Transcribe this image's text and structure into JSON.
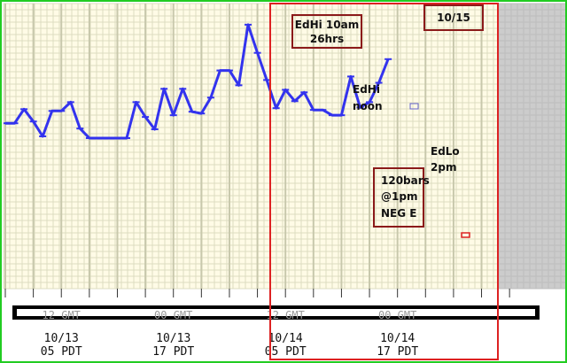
{
  "chart_data": {
    "type": "line",
    "title": "",
    "xlabel": "",
    "ylabel": "",
    "grid": true,
    "colors": {
      "background": "#fffbe6",
      "minor_grid": "#dcdcc0",
      "major_grid": "#c8c8ac",
      "line": "#3333ee",
      "highlight_box": "#dd2222",
      "annotation_border": "#8b1a1a",
      "outer_border": "#22cc22",
      "shaded": "#cccccc"
    },
    "x_range": [
      0,
      56.5
    ],
    "y_range": [
      0,
      100
    ],
    "series": [
      {
        "values": [
          {
            "x": 0,
            "y": 54.5
          },
          {
            "x": 1,
            "y": 54.5
          },
          {
            "x": 2,
            "y": 60.1
          },
          {
            "x": 3,
            "y": 55.2
          },
          {
            "x": 4,
            "y": 49.3
          },
          {
            "x": 5,
            "y": 59.4
          },
          {
            "x": 6,
            "y": 59.4
          },
          {
            "x": 7,
            "y": 62.9
          },
          {
            "x": 8,
            "y": 52.4
          },
          {
            "x": 9,
            "y": 48.6
          },
          {
            "x": 10,
            "y": 48.6
          },
          {
            "x": 11,
            "y": 48.6
          },
          {
            "x": 12,
            "y": 48.6
          },
          {
            "x": 13,
            "y": 48.6
          },
          {
            "x": 14,
            "y": 62.9
          },
          {
            "x": 15,
            "y": 57.0
          },
          {
            "x": 16,
            "y": 52.1
          },
          {
            "x": 17,
            "y": 68.2
          },
          {
            "x": 18,
            "y": 57.7
          },
          {
            "x": 19,
            "y": 68.2
          },
          {
            "x": 20,
            "y": 59.1
          },
          {
            "x": 21,
            "y": 58.4
          },
          {
            "x": 22,
            "y": 64.7
          },
          {
            "x": 23,
            "y": 75.5
          },
          {
            "x": 24,
            "y": 75.5
          },
          {
            "x": 25,
            "y": 69.6
          },
          {
            "x": 26,
            "y": 93.7
          },
          {
            "x": 27,
            "y": 82.5
          },
          {
            "x": 28,
            "y": 71.7
          },
          {
            "x": 29,
            "y": 60.5
          },
          {
            "x": 30,
            "y": 67.8
          },
          {
            "x": 31,
            "y": 63.3
          },
          {
            "x": 32,
            "y": 66.8
          },
          {
            "x": 33,
            "y": 59.8
          },
          {
            "x": 34,
            "y": 59.8
          },
          {
            "x": 35,
            "y": 57.7
          },
          {
            "x": 36,
            "y": 57.7
          },
          {
            "x": 37,
            "y": 73.1
          },
          {
            "x": 38,
            "y": 60.8
          },
          {
            "x": 39,
            "y": 62.9
          },
          {
            "x": 40,
            "y": 70.6
          },
          {
            "x": 41,
            "y": 80.0
          }
        ]
      }
    ],
    "x_tick_labels": [
      {
        "x": 6,
        "line1": "10/13",
        "line2": "05 PDT"
      },
      {
        "x": 18,
        "line1": "10/13",
        "line2": "17 PDT"
      },
      {
        "x": 30,
        "line1": "10/14",
        "line2": "05 PDT"
      },
      {
        "x": 42,
        "line1": "10/14",
        "line2": "17 PDT"
      }
    ],
    "x_tick_labels_upper": [
      {
        "x": 6,
        "text": "12 GMT"
      },
      {
        "x": 18,
        "text": "00 GMT"
      },
      {
        "x": 30,
        "text": "12 GMT"
      },
      {
        "x": 42,
        "text": "00 GMT"
      }
    ],
    "annotations": [
      {
        "id": "edhi-10am",
        "lines": [
          "EdHi 10am",
          "26hrs"
        ],
        "boxed": true
      },
      {
        "id": "date-box",
        "lines": [
          "10/15"
        ],
        "boxed": true
      },
      {
        "id": "edhi-noon",
        "lines": [
          "EdHi",
          "noon"
        ],
        "boxed": false
      },
      {
        "id": "edlo-2pm",
        "lines": [
          "EdLo",
          "2pm"
        ],
        "boxed": false
      },
      {
        "id": "bars-120",
        "lines": [
          "120bars",
          "@1pm",
          "NEG E"
        ],
        "boxed": true
      }
    ]
  }
}
